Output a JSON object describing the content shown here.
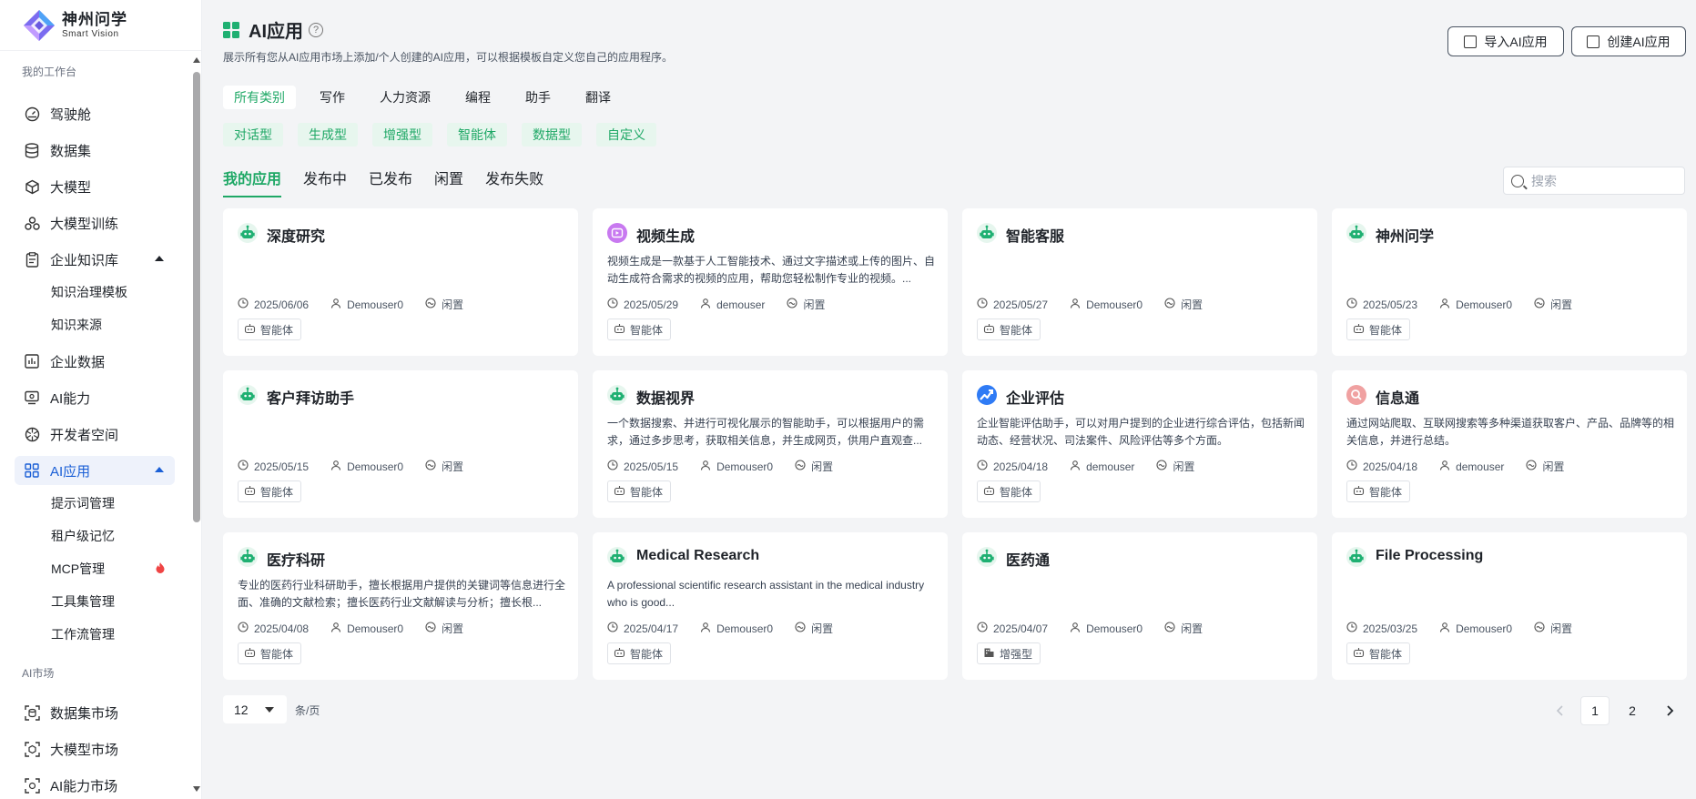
{
  "brand": {
    "name_cn": "神州问学",
    "name_en": "Smart Vision"
  },
  "sidebar": {
    "section_workbench": "我的工作台",
    "items": [
      {
        "label": "驾驶舱"
      },
      {
        "label": "数据集"
      },
      {
        "label": "大模型"
      },
      {
        "label": "大模型训练"
      },
      {
        "label": "企业知识库"
      },
      {
        "label": "企业数据"
      },
      {
        "label": "AI能力"
      },
      {
        "label": "开发者空间"
      },
      {
        "label": "AI应用"
      }
    ],
    "kb_sub": [
      "知识治理模板",
      "知识来源"
    ],
    "app_sub": [
      "提示词管理",
      "租户级记忆",
      "MCP管理",
      "工具集管理",
      "工作流管理"
    ],
    "section_market": "AI市场",
    "market_items": [
      {
        "label": "数据集市场"
      },
      {
        "label": "大模型市场"
      },
      {
        "label": "AI能力市场"
      }
    ]
  },
  "header": {
    "title": "AI应用",
    "help": "?",
    "description": "展示所有您从AI应用市场上添加/个人创建的AI应用，可以根据模板自定义您自己的应用程序。",
    "import_button": "导入AI应用",
    "create_button": "创建AI应用"
  },
  "categories": [
    "所有类别",
    "写作",
    "人力资源",
    "编程",
    "助手",
    "翻译"
  ],
  "types": [
    "对话型",
    "生成型",
    "增强型",
    "智能体",
    "数据型",
    "自定义"
  ],
  "tabs": [
    "我的应用",
    "发布中",
    "已发布",
    "闲置",
    "发布失败"
  ],
  "search": {
    "placeholder": "搜索"
  },
  "cards": [
    {
      "name": "深度研究",
      "desc": "",
      "date": "2025/06/06",
      "user": "Demouser0",
      "status": "闲置",
      "tag": "智能体",
      "icon": "robot-icon"
    },
    {
      "name": "视频生成",
      "desc": "视频生成是一款基于人工智能技术、通过文字描述或上传的图片、自动生成符合需求的视频的应用，帮助您轻松制作专业的视频。...",
      "date": "2025/05/29",
      "user": "demouser",
      "status": "闲置",
      "tag": "智能体",
      "icon": "video-icon"
    },
    {
      "name": "智能客服",
      "desc": "",
      "date": "2025/05/27",
      "user": "Demouser0",
      "status": "闲置",
      "tag": "智能体",
      "icon": "robot-icon"
    },
    {
      "name": "神州问学",
      "desc": "",
      "date": "2025/05/23",
      "user": "Demouser0",
      "status": "闲置",
      "tag": "智能体",
      "icon": "robot-icon"
    },
    {
      "name": "客户拜访助手",
      "desc": "",
      "date": "2025/05/15",
      "user": "Demouser0",
      "status": "闲置",
      "tag": "智能体",
      "icon": "robot-icon"
    },
    {
      "name": "数据视界",
      "desc": "一个数据搜索、并进行可视化展示的智能助手，可以根据用户的需求，通过多步思考，获取相关信息，并生成网页，供用户直观查...",
      "date": "2025/05/15",
      "user": "Demouser0",
      "status": "闲置",
      "tag": "智能体",
      "icon": "robot-icon"
    },
    {
      "name": "企业评估",
      "desc": "企业智能评估助手，可以对用户提到的企业进行综合评估，包括新闻动态、经营状况、司法案件、风险评估等多个方面。",
      "date": "2025/04/18",
      "user": "demouser",
      "status": "闲置",
      "tag": "智能体",
      "icon": "trend-icon"
    },
    {
      "name": "信息通",
      "desc": "通过网站爬取、互联网搜索等多种渠道获取客户、产品、品牌等的相关信息，并进行总结。",
      "date": "2025/04/18",
      "user": "demouser",
      "status": "闲置",
      "tag": "智能体",
      "icon": "search-icon"
    },
    {
      "name": "医疗科研",
      "desc": "专业的医药行业科研助手，擅长根据用户提供的关键词等信息进行全面、准确的文献检索；擅长医药行业文献解读与分析；擅长根...",
      "date": "2025/04/08",
      "user": "Demouser0",
      "status": "闲置",
      "tag": "智能体",
      "icon": "robot-icon"
    },
    {
      "name": "Medical Research",
      "desc": "A professional scientific research assistant in the medical industry who is good...",
      "date": "2025/04/17",
      "user": "Demouser0",
      "status": "闲置",
      "tag": "智能体",
      "icon": "robot-icon"
    },
    {
      "name": "医药通",
      "desc": "",
      "date": "2025/04/07",
      "user": "Demouser0",
      "status": "闲置",
      "tag": "增强型",
      "icon": "robot-icon"
    },
    {
      "name": "File Processing",
      "desc": "",
      "date": "2025/03/25",
      "user": "Demouser0",
      "status": "闲置",
      "tag": "智能体",
      "icon": "robot-icon"
    }
  ],
  "pagination": {
    "page_size": "12",
    "per_page_label": "条/页",
    "pages": [
      "1",
      "2"
    ],
    "current": "1"
  },
  "colors": {
    "accent_green": "#1fa866",
    "active_blue": "#1a5fd6"
  }
}
